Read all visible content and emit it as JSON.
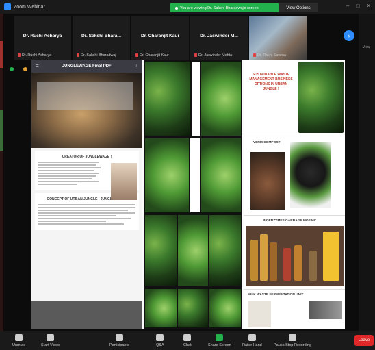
{
  "window": {
    "title": "Zoom Webinar"
  },
  "banner": {
    "text": "You are viewing Dr. Sakshi Bharadwaj's screen",
    "view_options": "View Options"
  },
  "participants": [
    {
      "name": "Dr. Ruchi Acharya",
      "sub": "Dr. Ruchi Acharya"
    },
    {
      "name": "Dr. Sakshi Bhara...",
      "sub": "Dr. Sakshi Bharadwaj"
    },
    {
      "name": "Dr. Charanjit Kaur",
      "sub": "Dr. Charanjit Kaur"
    },
    {
      "name": "Dr. Jaswinder M...",
      "sub": "Dr. Jaswinder Mehta"
    },
    {
      "name": "",
      "sub": "Dr. Rakhi Saxena"
    }
  ],
  "right_strip": {
    "label": "View"
  },
  "pdf": {
    "title": "JUNGLEWAGE Final PDF",
    "section1": "CREATOR OF JUNGLEWAGE !",
    "section2": "CONCEPT OF URBAN JUNGLE - JUNGLEWAGE !"
  },
  "col3": {
    "red_title": "SUSTAINABLE WASTE MANAGEMENT BUSINESS OPTIONS IN URBAN JUNGLE !",
    "vermi": "VERMICOMPOST",
    "bio": "BIOENZYMES/GARBAGE MOSAIC",
    "milk": "MILK WASTE FERMENTATION UNIT"
  },
  "toolbar": [
    {
      "label": "Unmute",
      "icon": "microphone-icon"
    },
    {
      "label": "Start Video",
      "icon": "video-icon"
    },
    {
      "label": "Participants",
      "icon": "participants-icon"
    },
    {
      "label": "Q&A",
      "icon": "qa-icon"
    },
    {
      "label": "Chat",
      "icon": "chat-icon"
    },
    {
      "label": "Share Screen",
      "icon": "share-screen-icon"
    },
    {
      "label": "Raise Hand",
      "icon": "raise-hand-icon"
    },
    {
      "label": "Pause/Stop Recording",
      "icon": "recording-icon"
    }
  ],
  "leave_label": "Leave",
  "colors": {
    "accent": "#2d8cff",
    "banner": "#22b14c",
    "leave": "#e02828"
  }
}
